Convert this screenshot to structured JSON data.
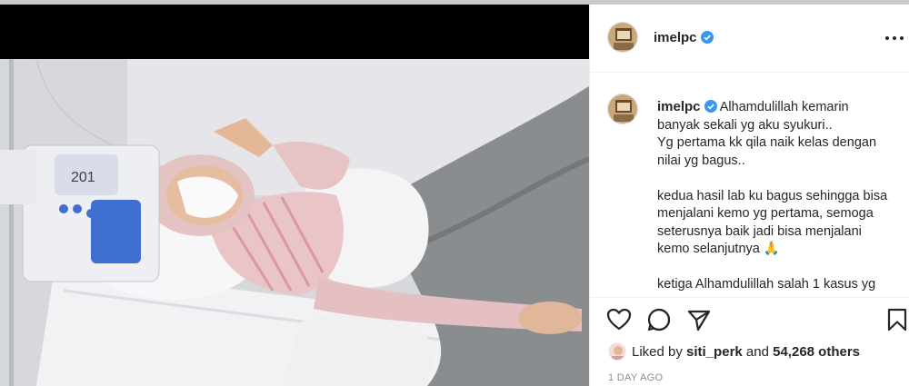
{
  "post": {
    "username": "imelpc",
    "caption_lines_first": "Alhamdulillah kemarin",
    "caption_lines": [
      "banyak sekali yg aku syukuri..",
      "Yg pertama kk qila naik kelas dengan",
      "nilai yg bagus..",
      "",
      "kedua hasil lab ku bagus sehingga bisa",
      "menjalani kemo yg pertama, semoga",
      "seterusnya baik jadi bisa menjalani",
      "kemo selanjutnya 🙏",
      "",
      "ketiga Alhamdulillah salah 1 kasus yg"
    ],
    "likes": {
      "prefix": "Liked by",
      "liker": "siti_perk",
      "joiner": "and",
      "count": "54,268 others"
    },
    "timestamp": "1 DAY AGO"
  },
  "icons": {
    "verified": "verified-badge-icon",
    "more": "more-options-icon",
    "like": "heart-icon",
    "comment": "comment-icon",
    "share": "paper-plane-icon",
    "save": "bookmark-icon"
  },
  "colors": {
    "verified": "#3897f0",
    "text": "#262626",
    "muted": "#8e8e8e",
    "divider": "#efefef"
  }
}
